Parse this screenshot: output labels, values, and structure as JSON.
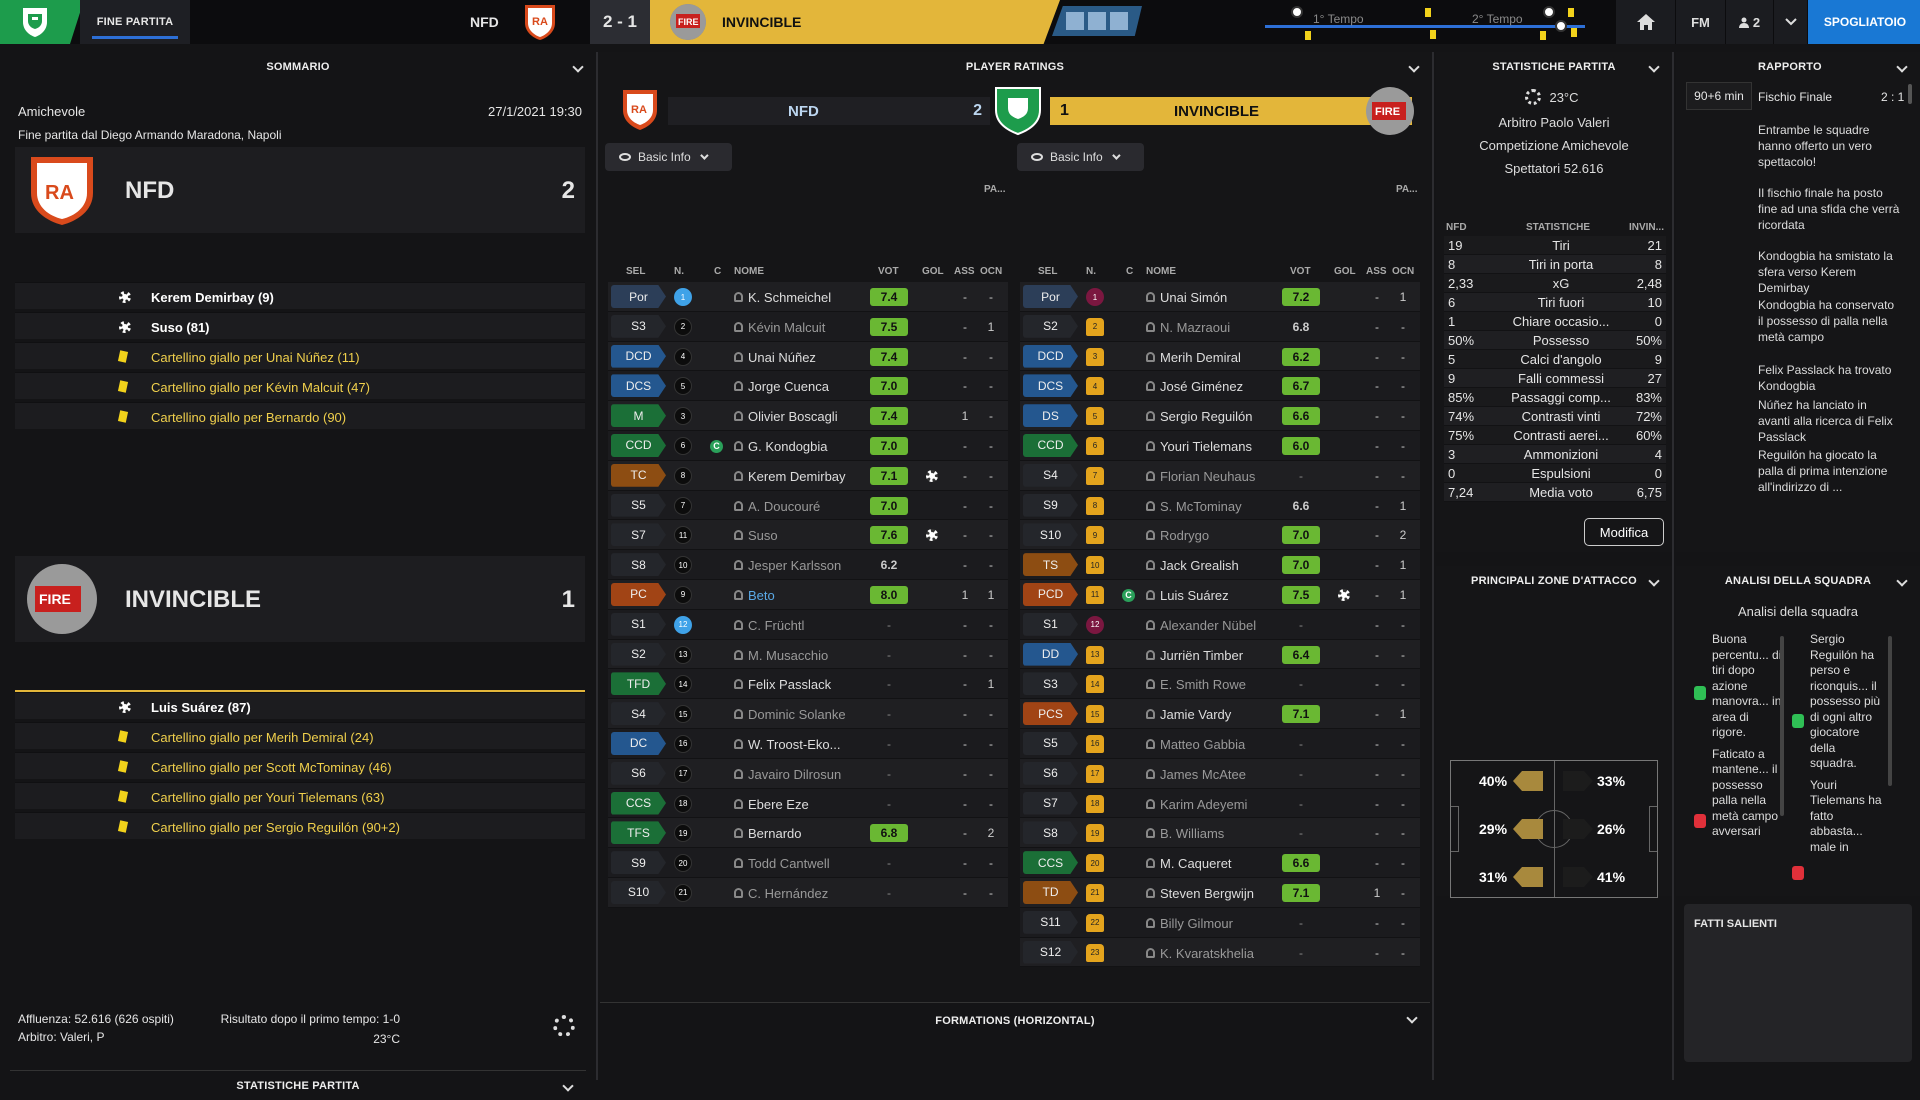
{
  "topbar": {
    "status": "FINE PARTITA",
    "home_name": "NFD",
    "score": "2 - 1",
    "away_name": "INVINCIBLE",
    "half1": "1° Tempo",
    "half2": "2° Tempo",
    "fm_label": "FM",
    "inbox_count": "2",
    "continue_label": "SPOGLIATOIO",
    "brand_green": "#1d9c4c",
    "accent_gold": "#e3b63a",
    "accent_blue": "#1978d4"
  },
  "summary": {
    "header": "SOMMARIO",
    "competition": "Amichevole",
    "datetime": "27/1/2021 19:30",
    "venue": "Fine partita dal Diego Armando Maradona, Napoli",
    "home": {
      "name": "NFD",
      "score": "2",
      "events": [
        {
          "type": "goal",
          "text": "Kerem Demirbay (9)"
        },
        {
          "type": "goal",
          "text": "Suso (81)"
        },
        {
          "type": "card",
          "text": "Cartellino giallo per Unai Núñez (11)"
        },
        {
          "type": "card",
          "text": "Cartellino giallo per Kévin Malcuit (47)"
        },
        {
          "type": "card",
          "text": "Cartellino giallo per Bernardo (90)"
        }
      ]
    },
    "away": {
      "name": "INVINCIBLE",
      "score": "1",
      "events": [
        {
          "type": "goal",
          "text": "Luis Suárez (87)"
        },
        {
          "type": "card",
          "text": "Cartellino giallo per Merih Demiral (24)"
        },
        {
          "type": "card",
          "text": "Cartellino giallo per Scott McTominay (46)"
        },
        {
          "type": "card",
          "text": "Cartellino giallo per Youri Tielemans (63)"
        },
        {
          "type": "card",
          "text": "Cartellino giallo per Sergio Reguilón (90+2)"
        }
      ]
    },
    "attendance": "Affluenza: 52.616 (626 ospiti)",
    "referee": "Arbitro: Valeri, P",
    "halftime": "Risultato dopo il primo tempo: 1-0",
    "temperature": "23°C",
    "bottom_header": "STATISTICHE PARTITA"
  },
  "ratings": {
    "header": "PLAYER RATINGS",
    "basic_info": "Basic Info",
    "col_pa": "PA...",
    "cols": {
      "sel": "SEL",
      "n": "N.",
      "c": "C",
      "name": "NOME",
      "vot": "VOT",
      "gol": "GOL",
      "ass": "ASS",
      "ocn": "OCN"
    },
    "home": {
      "name": "NFD",
      "score": "2",
      "players": [
        {
          "pos": "Por",
          "pc": "gk",
          "num": "1",
          "sc": "blue",
          "name": "K. Schmeichel",
          "rat": "7.4",
          "gol": "",
          "ass": "-",
          "ocn": "-",
          "sub": false
        },
        {
          "pos": "S3",
          "pc": "sub",
          "num": "2",
          "sc": "black",
          "name": "Kévin Malcuit",
          "rat": "7.5",
          "gol": "",
          "ass": "-",
          "ocn": "1",
          "sub": true
        },
        {
          "pos": "DCD",
          "pc": "def",
          "num": "4",
          "sc": "black",
          "name": "Unai Núñez",
          "rat": "7.4",
          "gol": "",
          "ass": "-",
          "ocn": "-",
          "sub": false
        },
        {
          "pos": "DCS",
          "pc": "def",
          "num": "5",
          "sc": "black",
          "name": "Jorge Cuenca",
          "rat": "7.0",
          "gol": "",
          "ass": "-",
          "ocn": "-",
          "sub": false
        },
        {
          "pos": "M",
          "pc": "mid",
          "num": "3",
          "sc": "black",
          "name": "Olivier Boscagli",
          "rat": "7.4",
          "gol": "",
          "ass": "1",
          "ocn": "-",
          "sub": false
        },
        {
          "pos": "CCD",
          "pc": "mid",
          "num": "6",
          "sc": "black",
          "name": "G. Kondogbia",
          "rat": "7.0",
          "gol": "",
          "ass": "-",
          "ocn": "-",
          "sub": false,
          "cap": "C"
        },
        {
          "pos": "TC",
          "pc": "attm",
          "num": "8",
          "sc": "black",
          "name": "Kerem Demirbay",
          "rat": "7.1",
          "gol": "ball",
          "ass": "-",
          "ocn": "-",
          "sub": false
        },
        {
          "pos": "S5",
          "pc": "sub",
          "num": "7",
          "sc": "black",
          "name": "A. Doucouré",
          "rat": "7.0",
          "gol": "",
          "ass": "-",
          "ocn": "-",
          "sub": true
        },
        {
          "pos": "S7",
          "pc": "sub",
          "num": "11",
          "sc": "black",
          "name": "Suso",
          "rat": "7.6",
          "gol": "ball",
          "ass": "-",
          "ocn": "-",
          "sub": true
        },
        {
          "pos": "S8",
          "pc": "sub",
          "num": "10",
          "sc": "black",
          "name": "Jesper Karlsson",
          "rat": "6.2",
          "gol": "",
          "ass": "-",
          "ocn": "-",
          "sub": true
        },
        {
          "pos": "PC",
          "pc": "att",
          "num": "9",
          "sc": "black",
          "name": "Beto",
          "rat": "8.0",
          "gol": "",
          "ass": "1",
          "ocn": "1",
          "sub": false,
          "scorer": true
        },
        {
          "pos": "S1",
          "pc": "sub",
          "num": "12",
          "sc": "blue",
          "name": "C. Früchtl",
          "rat": "-",
          "gol": "",
          "ass": "-",
          "ocn": "-",
          "sub": true
        },
        {
          "pos": "S2",
          "pc": "sub",
          "num": "13",
          "sc": "black",
          "name": "M. Musacchio",
          "rat": "-",
          "gol": "",
          "ass": "-",
          "ocn": "-",
          "sub": true
        },
        {
          "pos": "TFD",
          "pc": "mid",
          "num": "14",
          "sc": "black",
          "name": "Felix Passlack",
          "rat": "-",
          "gol": "",
          "ass": "-",
          "ocn": "1",
          "sub": false
        },
        {
          "pos": "S4",
          "pc": "sub",
          "num": "15",
          "sc": "black",
          "name": "Dominic Solanke",
          "rat": "-",
          "gol": "",
          "ass": "-",
          "ocn": "-",
          "sub": true
        },
        {
          "pos": "DC",
          "pc": "def",
          "num": "16",
          "sc": "black",
          "name": "W. Troost-Eko...",
          "rat": "-",
          "gol": "",
          "ass": "-",
          "ocn": "-",
          "sub": false
        },
        {
          "pos": "S6",
          "pc": "sub",
          "num": "17",
          "sc": "black",
          "name": "Javairo Dilrosun",
          "rat": "-",
          "gol": "",
          "ass": "-",
          "ocn": "-",
          "sub": true
        },
        {
          "pos": "CCS",
          "pc": "mid",
          "num": "18",
          "sc": "black",
          "name": "Ebere Eze",
          "rat": "-",
          "gol": "",
          "ass": "-",
          "ocn": "-",
          "sub": false
        },
        {
          "pos": "TFS",
          "pc": "mid",
          "num": "19",
          "sc": "black",
          "name": "Bernardo",
          "rat": "6.8",
          "gol": "",
          "ass": "-",
          "ocn": "2",
          "sub": false
        },
        {
          "pos": "S9",
          "pc": "sub",
          "num": "20",
          "sc": "black",
          "name": "Todd Cantwell",
          "rat": "-",
          "gol": "",
          "ass": "-",
          "ocn": "-",
          "sub": true
        },
        {
          "pos": "S10",
          "pc": "sub",
          "num": "21",
          "sc": "black",
          "name": "C. Hernández",
          "rat": "-",
          "gol": "",
          "ass": "-",
          "ocn": "-",
          "sub": true
        }
      ]
    },
    "away": {
      "name": "INVINCIBLE",
      "score": "1",
      "players": [
        {
          "pos": "Por",
          "pc": "gk",
          "num": "1",
          "sc": "maroon",
          "name": "Unai Simón",
          "rat": "7.2",
          "gol": "",
          "ass": "-",
          "ocn": "1",
          "sub": false
        },
        {
          "pos": "S2",
          "pc": "sub",
          "num": "2",
          "sc": "gold",
          "name": "N. Mazraoui",
          "rat": "6.8",
          "gol": "",
          "ass": "-",
          "ocn": "-",
          "sub": true
        },
        {
          "pos": "DCD",
          "pc": "def",
          "num": "3",
          "sc": "gold",
          "name": "Merih Demiral",
          "rat": "6.2",
          "gol": "",
          "ass": "-",
          "ocn": "-",
          "sub": false
        },
        {
          "pos": "DCS",
          "pc": "def",
          "num": "4",
          "sc": "gold",
          "name": "José Giménez",
          "rat": "6.7",
          "gol": "",
          "ass": "-",
          "ocn": "-",
          "sub": false
        },
        {
          "pos": "DS",
          "pc": "def",
          "num": "5",
          "sc": "gold",
          "name": "Sergio Reguilón",
          "rat": "6.6",
          "gol": "",
          "ass": "-",
          "ocn": "-",
          "sub": false
        },
        {
          "pos": "CCD",
          "pc": "mid",
          "num": "6",
          "sc": "gold",
          "name": "Youri Tielemans",
          "rat": "6.0",
          "gol": "",
          "ass": "-",
          "ocn": "-",
          "sub": false
        },
        {
          "pos": "S4",
          "pc": "sub",
          "num": "7",
          "sc": "gold",
          "name": "Florian Neuhaus",
          "rat": "-",
          "gol": "",
          "ass": "-",
          "ocn": "-",
          "sub": true
        },
        {
          "pos": "S9",
          "pc": "sub",
          "num": "8",
          "sc": "gold",
          "name": "S. McTominay",
          "rat": "6.6",
          "gol": "",
          "ass": "-",
          "ocn": "1",
          "sub": true
        },
        {
          "pos": "S10",
          "pc": "sub",
          "num": "9",
          "sc": "gold",
          "name": "Rodrygo",
          "rat": "7.0",
          "gol": "",
          "ass": "-",
          "ocn": "2",
          "sub": true
        },
        {
          "pos": "TS",
          "pc": "attm",
          "num": "10",
          "sc": "gold",
          "name": "Jack Grealish",
          "rat": "7.0",
          "gol": "",
          "ass": "-",
          "ocn": "1",
          "sub": false
        },
        {
          "pos": "PCD",
          "pc": "att",
          "num": "11",
          "sc": "gold",
          "name": "Luis Suárez",
          "rat": "7.5",
          "gol": "ball",
          "ass": "-",
          "ocn": "1",
          "sub": false,
          "cap": "C"
        },
        {
          "pos": "S1",
          "pc": "sub",
          "num": "12",
          "sc": "maroon",
          "name": "Alexander Nübel",
          "rat": "-",
          "gol": "",
          "ass": "-",
          "ocn": "-",
          "sub": true
        },
        {
          "pos": "DD",
          "pc": "def",
          "num": "13",
          "sc": "gold",
          "name": "Jurriën Timber",
          "rat": "6.4",
          "gol": "",
          "ass": "-",
          "ocn": "-",
          "sub": false
        },
        {
          "pos": "S3",
          "pc": "sub",
          "num": "14",
          "sc": "gold",
          "name": "E. Smith Rowe",
          "rat": "-",
          "gol": "",
          "ass": "-",
          "ocn": "-",
          "sub": true
        },
        {
          "pos": "PCS",
          "pc": "att",
          "num": "15",
          "sc": "gold",
          "name": "Jamie Vardy",
          "rat": "7.1",
          "gol": "",
          "ass": "-",
          "ocn": "1",
          "sub": false
        },
        {
          "pos": "S5",
          "pc": "sub",
          "num": "16",
          "sc": "gold",
          "name": "Matteo Gabbia",
          "rat": "-",
          "gol": "",
          "ass": "-",
          "ocn": "-",
          "sub": true
        },
        {
          "pos": "S6",
          "pc": "sub",
          "num": "17",
          "sc": "gold",
          "name": "James McAtee",
          "rat": "-",
          "gol": "",
          "ass": "-",
          "ocn": "-",
          "sub": true
        },
        {
          "pos": "S7",
          "pc": "sub",
          "num": "18",
          "sc": "gold",
          "name": "Karim Adeyemi",
          "rat": "-",
          "gol": "",
          "ass": "-",
          "ocn": "-",
          "sub": true
        },
        {
          "pos": "S8",
          "pc": "sub",
          "num": "19",
          "sc": "gold",
          "name": "B. Williams",
          "rat": "-",
          "gol": "",
          "ass": "-",
          "ocn": "-",
          "sub": true
        },
        {
          "pos": "CCS",
          "pc": "mid",
          "num": "20",
          "sc": "gold",
          "name": "M. Caqueret",
          "rat": "6.6",
          "gol": "",
          "ass": "-",
          "ocn": "-",
          "sub": false
        },
        {
          "pos": "TD",
          "pc": "attm",
          "num": "21",
          "sc": "gold",
          "name": "Steven Bergwijn",
          "rat": "7.1",
          "gol": "",
          "ass": "1",
          "ocn": "-",
          "sub": false
        },
        {
          "pos": "S11",
          "pc": "sub",
          "num": "22",
          "sc": "gold",
          "name": "Billy Gilmour",
          "rat": "-",
          "gol": "",
          "ass": "-",
          "ocn": "-",
          "sub": true
        },
        {
          "pos": "S12",
          "pc": "sub",
          "num": "23",
          "sc": "gold",
          "name": "K. Kvaratskhelia",
          "rat": "-",
          "gol": "",
          "ass": "-",
          "ocn": "-",
          "sub": true
        }
      ]
    },
    "formations_header": "FORMATIONS (HORIZONTAL)"
  },
  "match_stats": {
    "header": "STATISTICHE PARTITA",
    "temperature": "23°C",
    "referee": "Arbitro Paolo Valeri",
    "competition": "Competizione Amichevole",
    "spectators": "Spettatori 52.616",
    "col_home": "NFD",
    "col_stat": "STATISTICHE",
    "col_away": "INVIN...",
    "rows": [
      {
        "h": "19",
        "s": "Tiri",
        "a": "21"
      },
      {
        "h": "8",
        "s": "Tiri in porta",
        "a": "8"
      },
      {
        "h": "2,33",
        "s": "xG",
        "a": "2,48"
      },
      {
        "h": "6",
        "s": "Tiri fuori",
        "a": "10"
      },
      {
        "h": "1",
        "s": "Chiare occasio...",
        "a": "0"
      },
      {
        "h": "50%",
        "s": "Possesso",
        "a": "50%"
      },
      {
        "h": "5",
        "s": "Calci d'angolo",
        "a": "9"
      },
      {
        "h": "9",
        "s": "Falli commessi",
        "a": "27"
      },
      {
        "h": "85%",
        "s": "Passaggi comp...",
        "a": "83%"
      },
      {
        "h": "74%",
        "s": "Contrasti vinti",
        "a": "72%"
      },
      {
        "h": "75%",
        "s": "Contrasti aerei...",
        "a": "60%"
      },
      {
        "h": "3",
        "s": "Ammonizioni",
        "a": "4"
      },
      {
        "h": "0",
        "s": "Espulsioni",
        "a": "0"
      },
      {
        "h": "7,24",
        "s": "Media voto",
        "a": "6,75"
      }
    ],
    "edit_label": "Modifica"
  },
  "attack_zones": {
    "header": "PRINCIPALI ZONE D'ATTACCO",
    "home": {
      "left": "40%",
      "center": "29%",
      "right": "31%"
    },
    "away": {
      "left": "33%",
      "center": "26%",
      "right": "41%"
    }
  },
  "report": {
    "header": "RAPPORTO",
    "time": "90+6 min",
    "final": "Fischio Finale",
    "score": "2 : 1",
    "items": [
      "Entrambe le squadre hanno offerto un vero spettacolo!",
      "Il fischio finale ha posto fine ad una sfida che verrà ricordata",
      "Kondogbia ha smistato la sfera verso Kerem Demirbay",
      "Kondogbia ha conservato il possesso di palla nella metà campo",
      "Felix Passlack ha trovato Kondogbia",
      "Núñez ha lanciato in avanti alla ricerca di Felix Passlack",
      "Reguilón ha giocato la palla di prima intenzione all'indirizzo di ..."
    ]
  },
  "analysis": {
    "header": "ANALISI DELLA SQUADRA",
    "subtitle": "Analisi della squadra",
    "left": [
      "Buona percentu... di tiri dopo azione manovra... in area di rigore.",
      "Faticato a mantene... il possesso palla nella metà campo avversari"
    ],
    "right": [
      "Sergio Reguilón ha perso e riconquis... il possesso più di ogni altro giocatore della squadra.",
      "Youri Tielemans ha fatto abbasta... male in"
    ]
  },
  "key_facts": {
    "header": "FATTI SALIENTI"
  }
}
